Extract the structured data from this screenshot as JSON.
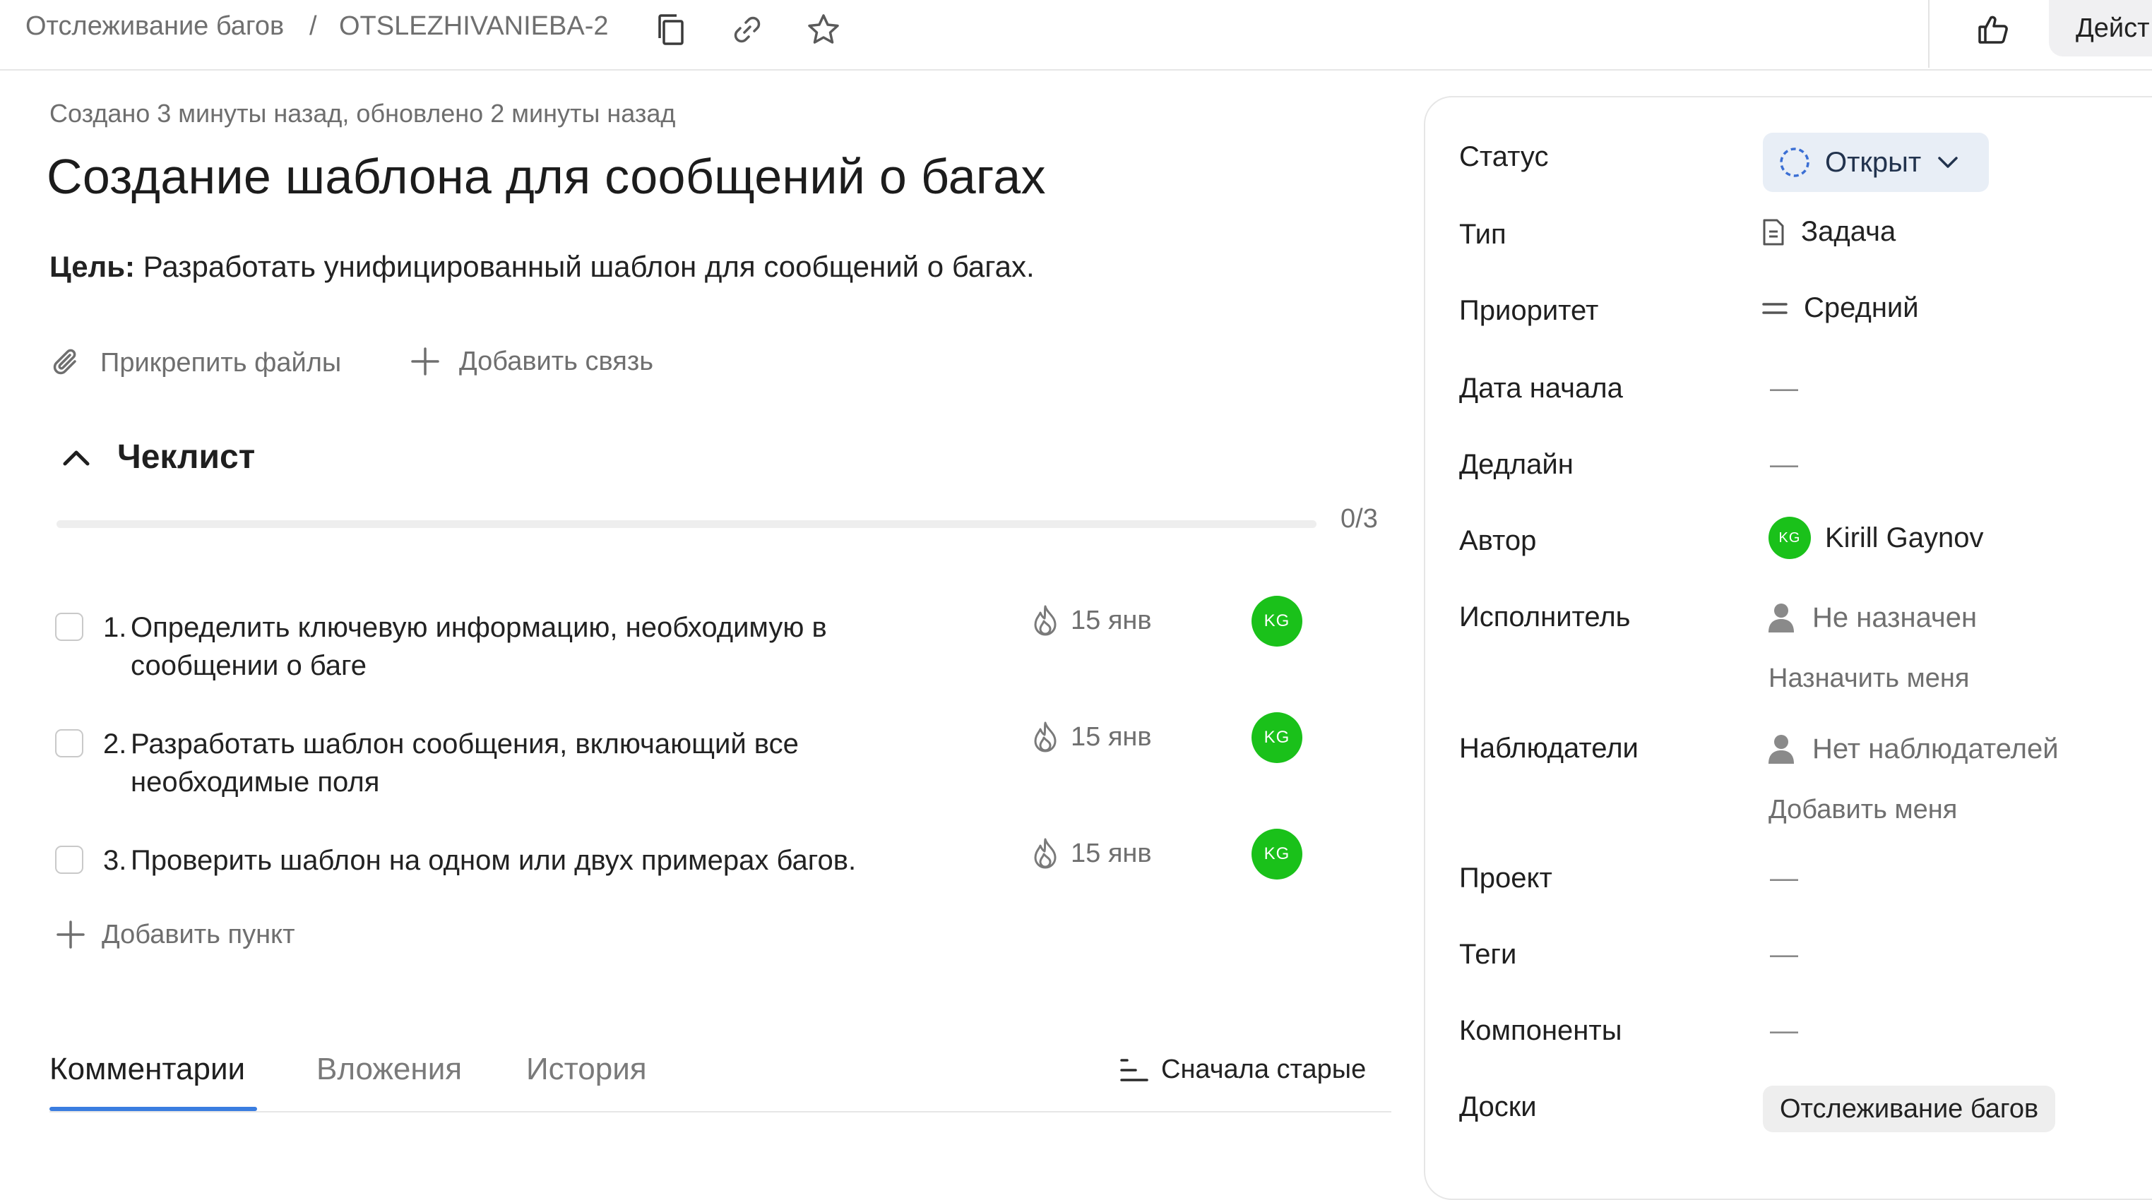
{
  "breadcrumb": {
    "project": "Отслеживание багов",
    "separator": "/",
    "issue_key": "OTSLEZHIVANIEBA-2"
  },
  "header": {
    "actions_label": "Дейст"
  },
  "issue": {
    "meta": "Создано 3 минуты назад, обновлено 2 минуты назад",
    "title": "Создание шаблона для сообщений о багах",
    "goal_label": "Цель:",
    "goal_text": "Разработать унифицированный шаблон для сообщений о багах."
  },
  "attach": {
    "files_label": "Прикрепить файлы",
    "link_label": "Добавить связь"
  },
  "checklist": {
    "title": "Чеклист",
    "progress_text": "0/3",
    "progress_fraction": 0,
    "items": [
      {
        "num": "1.",
        "line1": "Определить ключевую информацию, необходимую в",
        "line2": "сообщении о баге",
        "date": "15 янв",
        "avatar": "KG"
      },
      {
        "num": "2.",
        "line1": "Разработать шаблон сообщения, включающий все",
        "line2": "необходимые поля",
        "date": "15 янв",
        "avatar": "KG"
      },
      {
        "num": "3.",
        "line1": "Проверить шаблон на одном или двух примерах багов.",
        "line2": "",
        "date": "15 янв",
        "avatar": "KG"
      }
    ],
    "add_label": "Добавить пункт"
  },
  "tabs": {
    "comments": "Комментарии",
    "attachments": "Вложения",
    "history": "История",
    "sort_label": "Сначала старые"
  },
  "fields": {
    "status_label": "Статус",
    "status_value": "Открыт",
    "type_label": "Тип",
    "type_value": "Задача",
    "priority_label": "Приоритет",
    "priority_value": "Средний",
    "start_label": "Дата начала",
    "start_value": "—",
    "deadline_label": "Дедлайн",
    "deadline_value": "—",
    "author_label": "Автор",
    "author_avatar": "KG",
    "author_name": "Kirill Gaynov",
    "assignee_label": "Исполнитель",
    "assignee_value": "Не назначен",
    "assign_me": "Назначить меня",
    "followers_label": "Наблюдатели",
    "followers_value": "Нет наблюдателей",
    "add_me": "Добавить меня",
    "project_label": "Проект",
    "project_value": "—",
    "tags_label": "Теги",
    "tags_value": "—",
    "components_label": "Компоненты",
    "components_value": "—",
    "boards_label": "Доски",
    "boards_value": "Отслеживание багов"
  },
  "colors": {
    "avatar_green": "#1ac11a",
    "accent_blue": "#3a7de0",
    "status_bg": "#e8eef6"
  }
}
